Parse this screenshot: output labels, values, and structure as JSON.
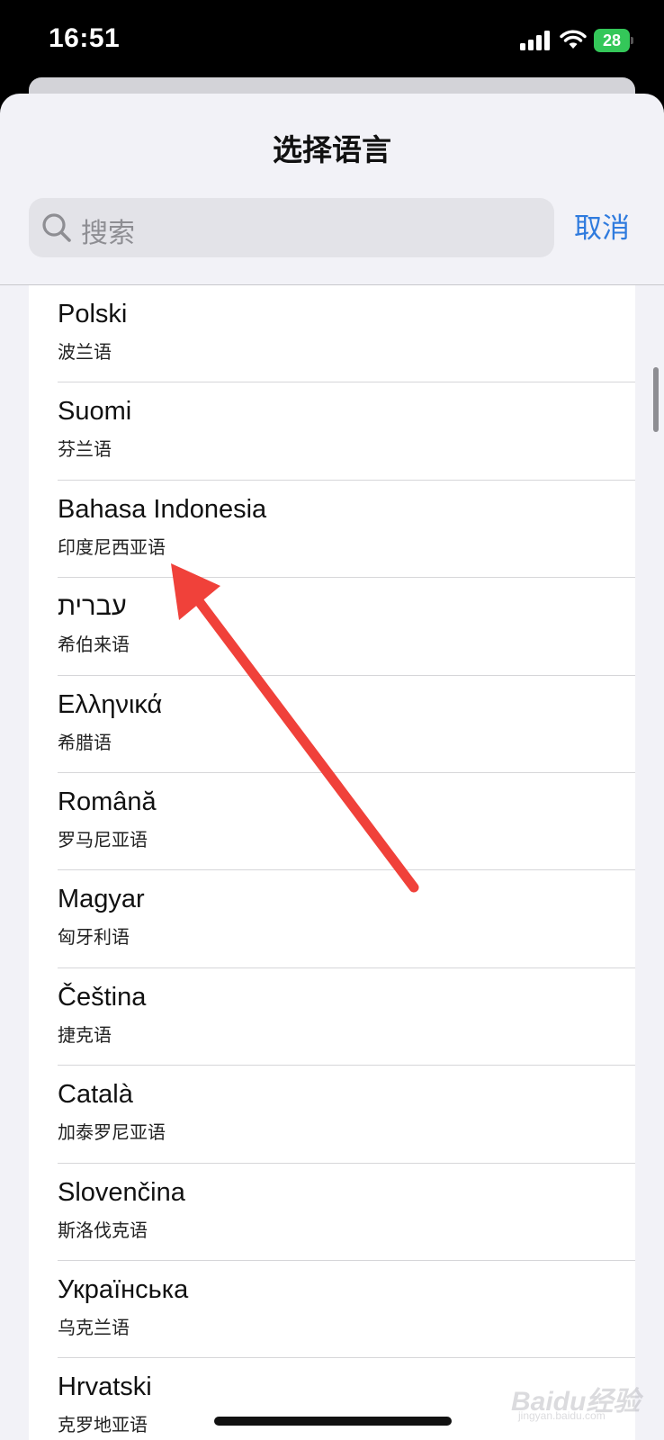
{
  "status_bar": {
    "time": "16:51",
    "battery": "28"
  },
  "sheet": {
    "title": "选择语言"
  },
  "search": {
    "placeholder": "搜索"
  },
  "cancel_label": "取消",
  "languages": [
    {
      "name": "Polski",
      "sub": "波兰语"
    },
    {
      "name": "Suomi",
      "sub": "芬兰语"
    },
    {
      "name": "Bahasa Indonesia",
      "sub": "印度尼西亚语"
    },
    {
      "name": "עברית",
      "sub": "希伯来语"
    },
    {
      "name": "Ελληνικά",
      "sub": "希腊语"
    },
    {
      "name": "Română",
      "sub": "罗马尼亚语"
    },
    {
      "name": "Magyar",
      "sub": "匈牙利语"
    },
    {
      "name": "Čeština",
      "sub": "捷克语"
    },
    {
      "name": "Català",
      "sub": "加泰罗尼亚语"
    },
    {
      "name": "Slovenčina",
      "sub": "斯洛伐克语"
    },
    {
      "name": "Українська",
      "sub": "乌克兰语"
    },
    {
      "name": "Hrvatski",
      "sub": "克罗地亚语"
    }
  ],
  "watermark": {
    "text": "Baidu经验",
    "sub": "jingyan.baidu.com"
  },
  "colors": {
    "accent": "#2f7bde",
    "annotation": "#f0413a",
    "battery": "#34c759"
  }
}
